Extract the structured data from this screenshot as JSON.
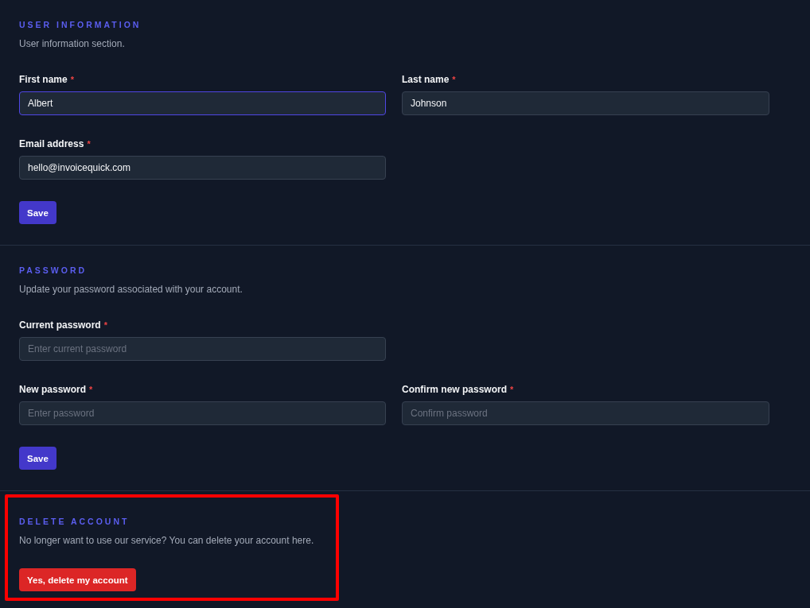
{
  "sections": [
    {
      "title": "USER INFORMATION",
      "description": "User information section.",
      "highlighted": false,
      "rows": [
        [
          {
            "label": "First name",
            "required_mark": "*",
            "value": "Albert",
            "focused": true
          },
          {
            "label": "Last name",
            "required_mark": "*",
            "value": "Johnson",
            "focused": false
          }
        ],
        [
          {
            "label": "Email address",
            "required_mark": "*",
            "value": "hello@invoicequick.com",
            "focused": false
          }
        ]
      ],
      "button": {
        "label": "Save",
        "kind": "primary"
      }
    },
    {
      "title": "PASSWORD",
      "description": "Update your password associated with your account.",
      "highlighted": false,
      "rows": [
        [
          {
            "label": "Current password",
            "required_mark": "*",
            "placeholder": "Enter current password",
            "focused": false
          }
        ],
        [
          {
            "label": "New password",
            "required_mark": "*",
            "placeholder": "Enter password",
            "focused": false
          },
          {
            "label": "Confirm new password",
            "required_mark": "*",
            "placeholder": "Confirm password",
            "focused": false
          }
        ]
      ],
      "button": {
        "label": "Save",
        "kind": "primary"
      }
    },
    {
      "title": "DELETE ACCOUNT",
      "description": "No longer want to use our service? You can delete your account here.",
      "highlighted": true,
      "button": {
        "label": "Yes, delete my account",
        "kind": "danger"
      }
    }
  ]
}
